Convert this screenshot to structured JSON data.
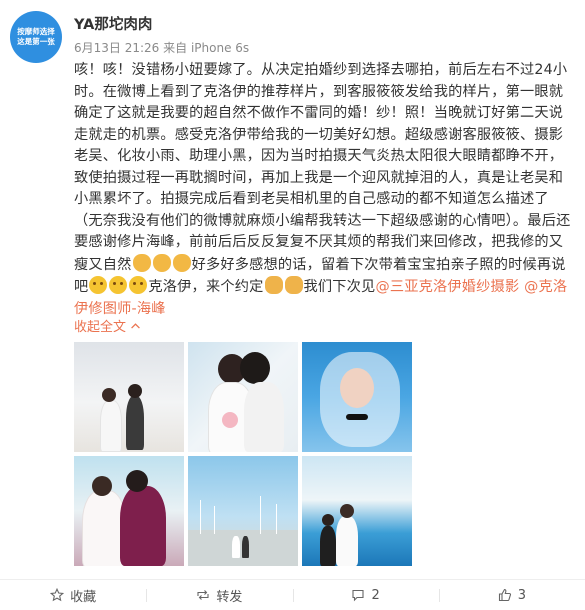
{
  "avatar": {
    "line1": "按摩师选择",
    "line2": "这是第一张"
  },
  "user": {
    "name": "YA那坨肉肉"
  },
  "meta": {
    "time": "6月13日 21:26",
    "source": "来自 iPhone 6s"
  },
  "post": {
    "p1": "咳！咳！没错杨小妞要嫁了。从决定拍婚纱到选择去哪拍，前后左右不过24小时。在微博上看到了克洛伊的推荐样片，到客服筱筱发给我的样片，第一眼就确定了这就是我要的超自然不做作不雷同的婚！纱！照！当晚就订好第二天说走就走的机票。感受克洛伊带给我的一切美好幻想。超级感谢客服筱筱、摄影老吴、化妆小雨、助理小黑，因为当时拍摄天气炎热太阳很大眼睛都睁不开，致使拍摄过程一再耽搁时间，再加上我是一个迎风就掉泪的人，真是让老吴和小黑累坏了。拍摄完成后看到老吴相机里的自己感动的都不知道怎么描述了（无奈我没有他们的微博就麻烦小编帮我转达一下超级感谢的心情吧）。最后还要感谢修片海峰，前前后后反反复复不厌其烦的帮我们来回修改，把我修的又瘦又自然",
    "p2": "好多好多感想的话，留着下次带着宝宝拍亲子照的时候再说吧",
    "p3": "克洛伊，来个约定",
    "p4": "我们下次见",
    "mention1": "@三亚克洛伊婚纱摄影",
    "mention2": "@克洛伊修图师-海峰"
  },
  "collapse_label": "收起全文",
  "actions": {
    "favorite": "收藏",
    "repost": "转发",
    "comment_count": "2",
    "like_count": "3"
  }
}
